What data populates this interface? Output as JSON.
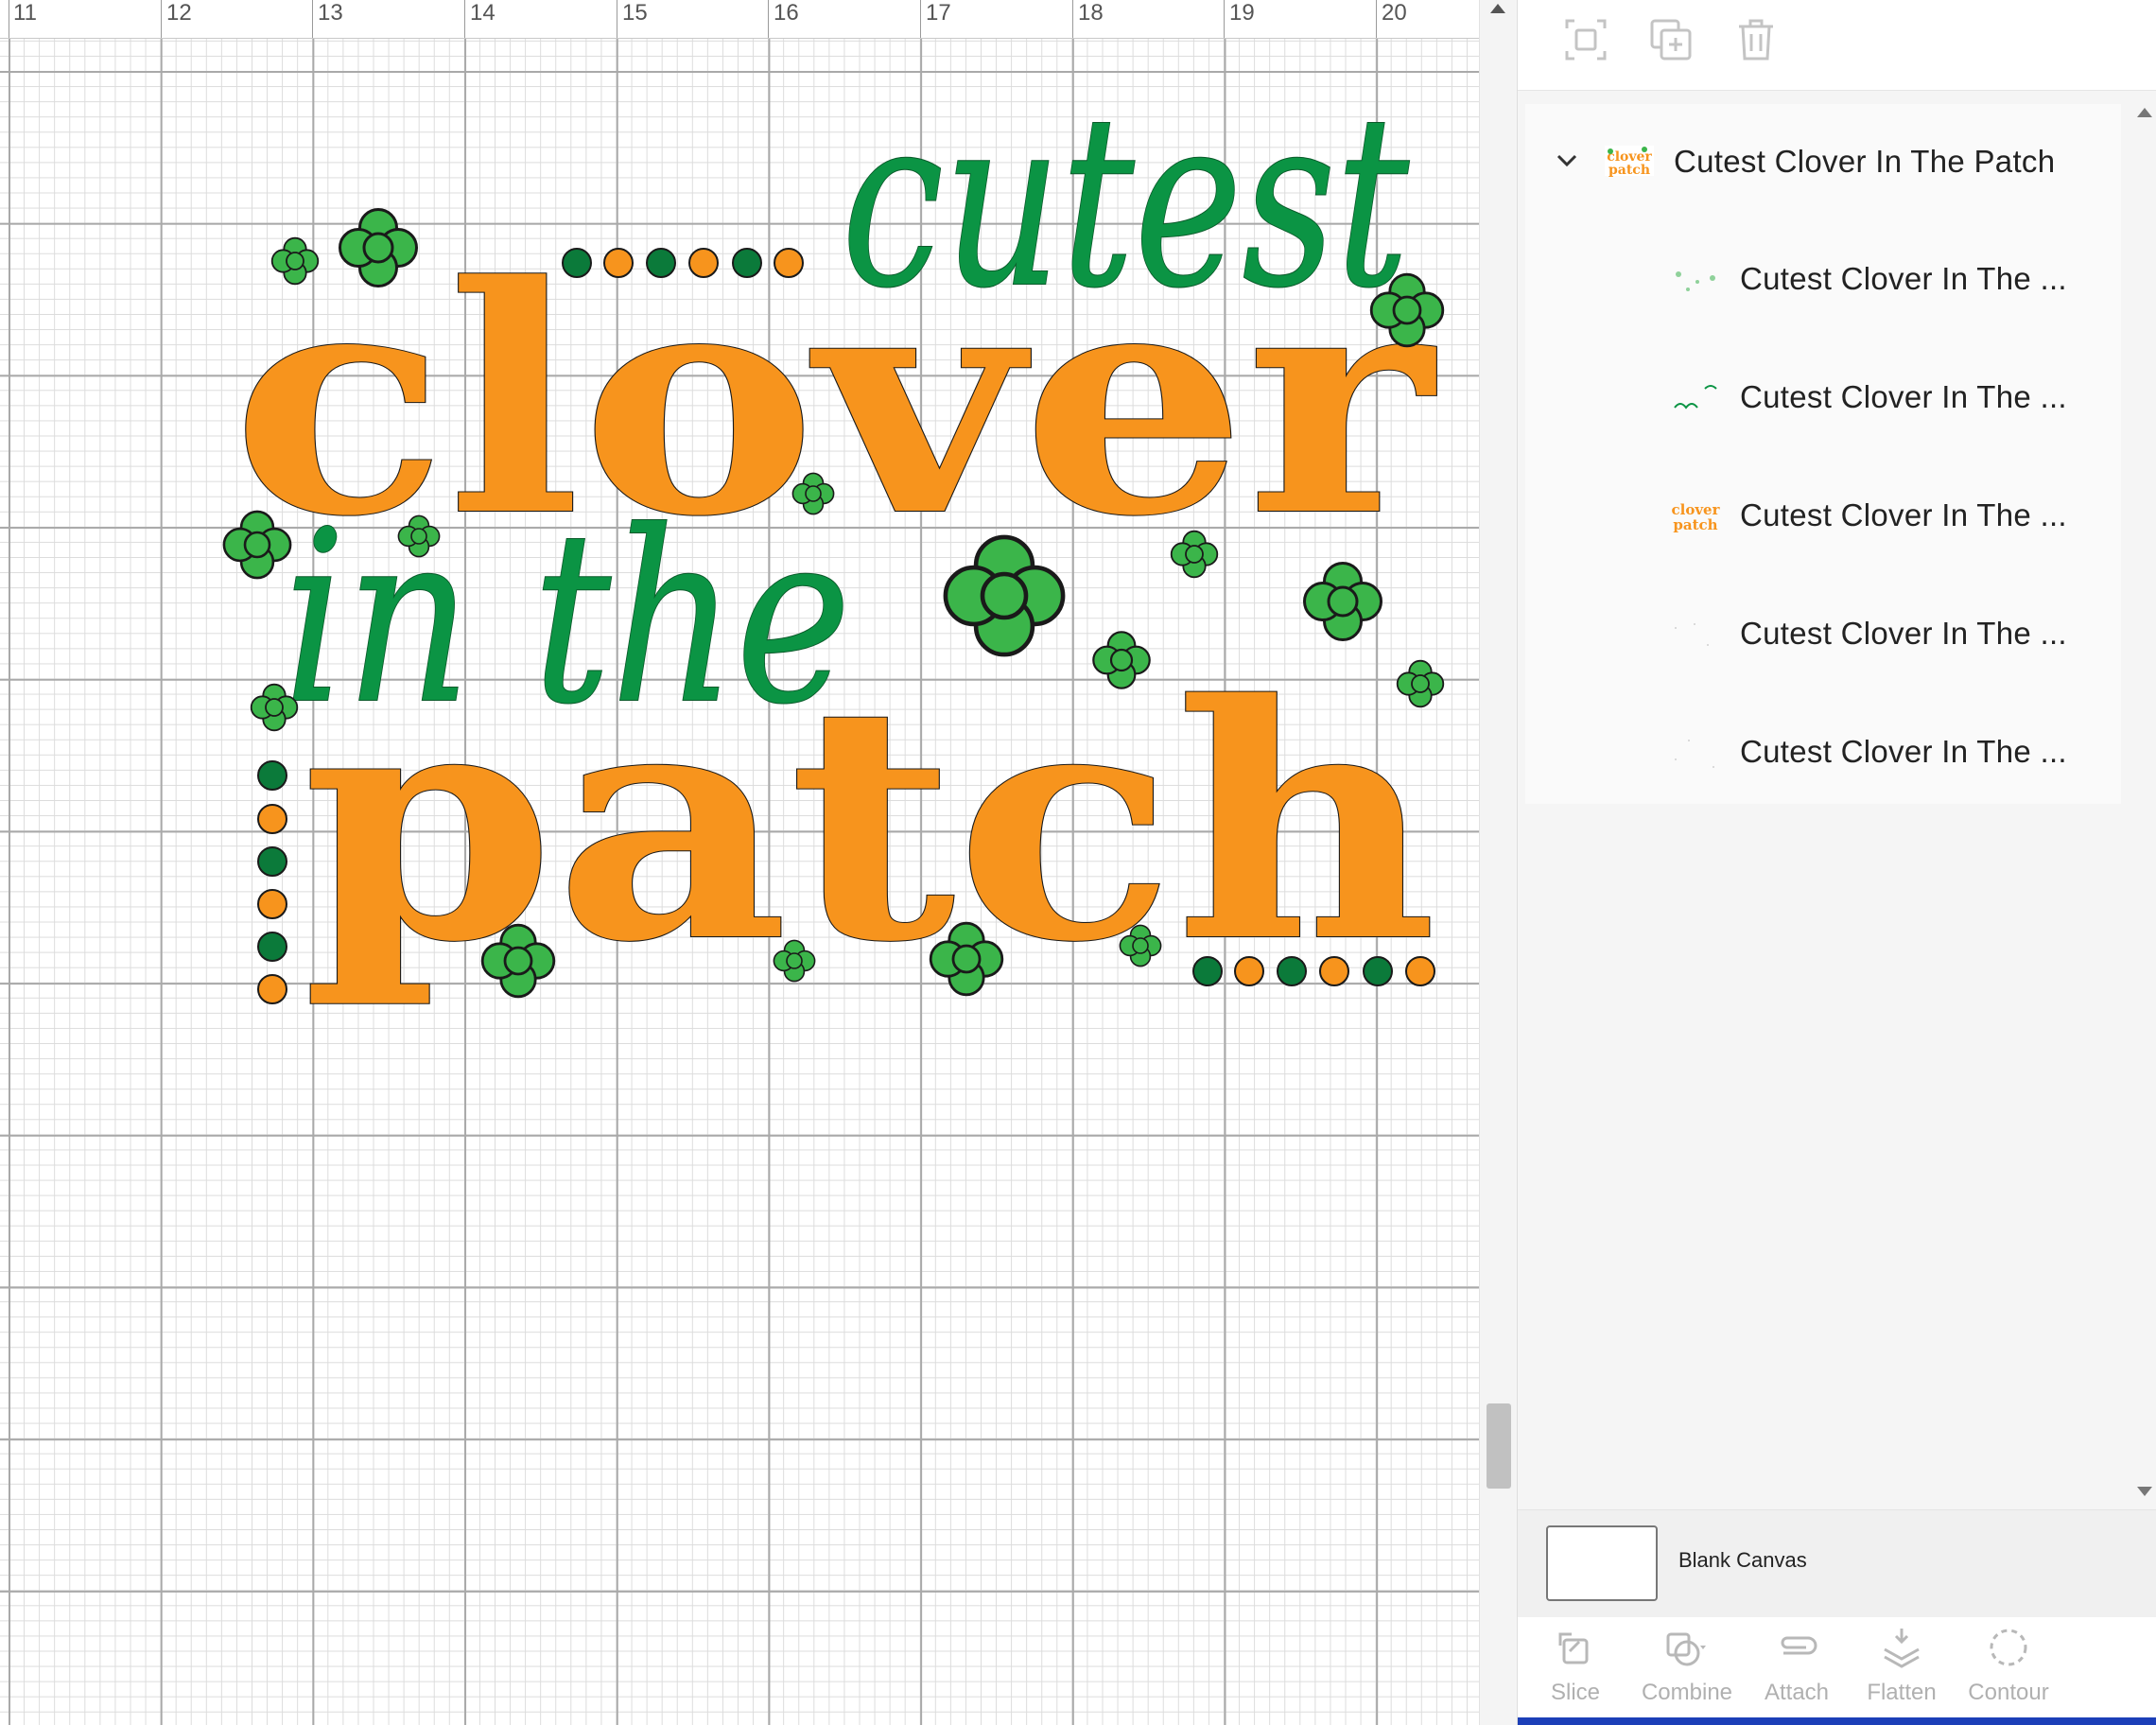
{
  "ruler": {
    "ticks": [
      "11",
      "12",
      "13",
      "14",
      "15",
      "16",
      "17",
      "18",
      "19",
      "20"
    ]
  },
  "design": {
    "line1": "cutest",
    "line2": "clover",
    "line3": "in the",
    "line4": "patch",
    "colors": {
      "orange": "#F7941D",
      "green": "#0B9444",
      "clover": "#3BB54A",
      "dark_green": "#0B7A3A",
      "outline": "#1a1a1a"
    }
  },
  "toolbar": {
    "icons": [
      "group-icon",
      "duplicate-icon",
      "delete-icon"
    ]
  },
  "layers": {
    "group": {
      "name": "Cutest Clover In The Patch",
      "expanded": true
    },
    "children": [
      {
        "name": "Cutest Clover In The ...",
        "thumb": "clovers"
      },
      {
        "name": "Cutest Clover In The ...",
        "thumb": "green-text"
      },
      {
        "name": "Cutest Clover In The ...",
        "thumb": "orange-text"
      },
      {
        "name": "Cutest Clover In The ...",
        "thumb": "faint"
      },
      {
        "name": "Cutest Clover In The ...",
        "thumb": "faint"
      }
    ]
  },
  "canvas": {
    "label": "Blank Canvas"
  },
  "bottom_tools": [
    {
      "label": "Slice",
      "icon": "slice-icon"
    },
    {
      "label": "Combine",
      "icon": "combine-icon"
    },
    {
      "label": "Attach",
      "icon": "attach-icon"
    },
    {
      "label": "Flatten",
      "icon": "flatten-icon"
    },
    {
      "label": "Contour",
      "icon": "contour-icon"
    }
  ],
  "thumb_text": {
    "clover": "clover",
    "patch": "patch"
  }
}
